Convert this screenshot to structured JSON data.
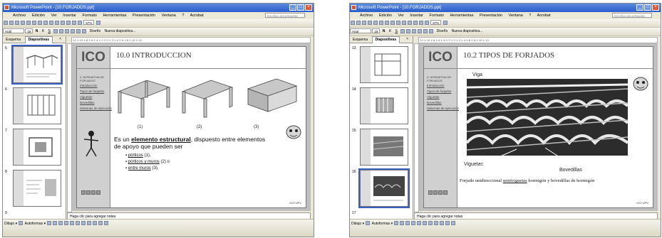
{
  "windows": [
    {
      "title": "Microsoft PowerPoint - [10.FORJADOS.ppt]",
      "menu": [
        "Archivo",
        "Edición",
        "Ver",
        "Insertar",
        "Formato",
        "Herramientas",
        "Presentación",
        "Ventana",
        "?",
        "Acrobat"
      ],
      "help_placeholder": "Escriba una pregunta",
      "zoom": "67%",
      "font_name": "Arial",
      "font_size": "18",
      "design_label": "Diseño",
      "new_slide_label": "Nueva diapositiva...",
      "tabs": {
        "outline": "Esquema",
        "slides": "Diapositivas"
      },
      "thumb_numbers": [
        "5",
        "6",
        "7",
        "8",
        "9"
      ],
      "notes_placeholder": "Haga clic para agregar notas",
      "draw_label": "Dibujo",
      "autoshapes_label": "Autoformas",
      "slide": {
        "logo": "ICO",
        "title": "10.0 INTRODUCCION",
        "nav_heading": "0. NORMATIVA DE FORJADOS",
        "nav_items": [
          "Introducción",
          "Tipos de forjados",
          "Viguetas",
          "Bovedillas",
          "Sistemas de ejecución"
        ],
        "diagram_labels": [
          "(1)",
          "(2)",
          "(3)"
        ],
        "body_prefix": "Es un ",
        "body_bold": "elemento estructural",
        "body_suffix": ", dispuesto entre elementos de apoyo que pueden ser",
        "bullets": [
          {
            "link": "pórticos",
            "rest": " (1),"
          },
          {
            "link": "pórticos y muros",
            "rest": " (2) o"
          },
          {
            "link": "entre muros",
            "rest": " (3)."
          }
        ],
        "credit": "ICO·UPV"
      }
    },
    {
      "title": "Microsoft PowerPoint - [10.FORJADOS.ppt]",
      "menu": [
        "Archivo",
        "Edición",
        "Ver",
        "Insertar",
        "Formato",
        "Herramientas",
        "Presentación",
        "Ventana",
        "?",
        "Acrobat"
      ],
      "help_placeholder": "Escriba una pregunta",
      "zoom": "67%",
      "font_name": "Arial",
      "font_size": "18",
      "design_label": "Diseño",
      "new_slide_label": "Nueva diapositiva...",
      "tabs": {
        "outline": "Esquema",
        "slides": "Diapositivas"
      },
      "thumb_numbers": [
        "13",
        "14",
        "15",
        "16",
        "17"
      ],
      "notes_placeholder": "Haga clic para agregar notas",
      "draw_label": "Dibujo",
      "autoshapes_label": "Autoformas",
      "slide": {
        "logo": "ICO",
        "title": "10.2 TIPOS DE FORJADOS",
        "nav_heading": "0. NORMATIVA DE FORJADOS",
        "nav_items": [
          "Introducción",
          "Tipos de forjados",
          "Viguetas",
          "Bovedillas",
          "Sistemas de ejecución"
        ],
        "photo_labels": {
          "beam": "Viga",
          "joists": "Viguetas",
          "blocks": "Bovedillas"
        },
        "caption_prefix": "Forjado unidireccional ",
        "caption_link": "semiviguetas",
        "caption_suffix": " hormigón y bovedillas de hormigón",
        "credit": "ICO·UPV"
      }
    }
  ]
}
